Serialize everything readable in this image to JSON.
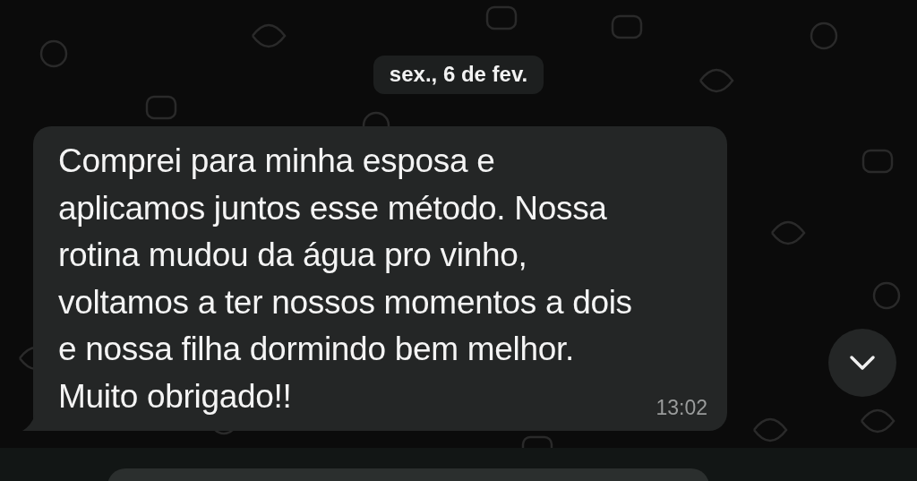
{
  "date_chip": "sex., 6 de fev.",
  "message": {
    "text": "Comprei para minha esposa e\naplicamos juntos esse método. Nossa\nrotina mudou da água pro vinho,\nvoltamos a ter nossos momentos a dois\ne nossa filha dormindo bem melhor.\nMuito obrigado!!",
    "time": "13:02"
  }
}
